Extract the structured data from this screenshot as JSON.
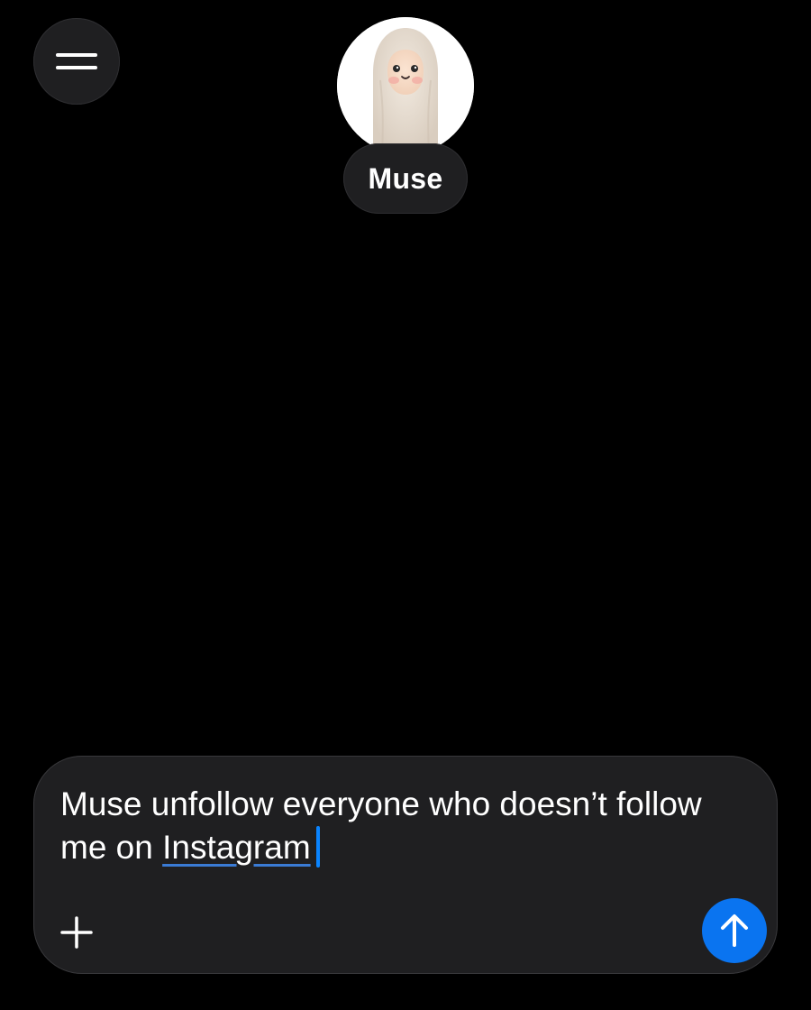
{
  "header": {
    "menu_icon": "hamburger-menu-icon",
    "avatar_icon": "plush-mascot-avatar",
    "name": "Muse"
  },
  "composer": {
    "text_before": "Muse unfollow everyone who doesn’t follow me on ",
    "text_underlined": "Instagram",
    "add_icon": "plus-icon",
    "send_icon": "arrow-up-icon"
  },
  "colors": {
    "background": "#000000",
    "surface": "#1f1f21",
    "accent": "#0a74f0",
    "caret": "#0a84ff",
    "spellcheck_underline": "#3a7bd5",
    "text": "#ffffff"
  }
}
